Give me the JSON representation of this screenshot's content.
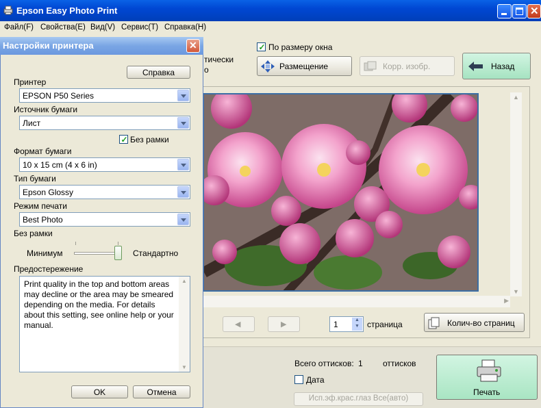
{
  "window": {
    "title": "Epson Easy Photo Print"
  },
  "menu": [
    "Файл(F)",
    "Свойства(E)",
    "Вид(V)",
    "Сервис(T)",
    "Справка(H)"
  ],
  "toolbar": {
    "fit_window_label": "По размеру окна",
    "fit_window_checked": true,
    "placement_label": "Размещение",
    "correct_label": "Корр. изобр.",
    "back_label": "Назад",
    "partial_text_1": "тически",
    "partial_text_2": "о"
  },
  "pager": {
    "page_value": "1",
    "page_label": "страница",
    "pages_count_button": "Колич-во страниц"
  },
  "bottom": {
    "total_label": "Всего оттисков:",
    "total_value": "1",
    "total_unit": "оттисков",
    "date_label": "Дата",
    "date_checked": false,
    "redeye_label": "Исп.эф.крас.глаз Все(авто)",
    "print_label": "Печать"
  },
  "dialog": {
    "title": "Настройки принтера",
    "help_button": "Справка",
    "printer_label": "Принтер",
    "printer_value": "EPSON P50 Series",
    "source_label": "Источник бумаги",
    "source_value": "Лист",
    "borderless_check_label": "Без рамки",
    "borderless_checked": true,
    "size_label": "Формат бумаги",
    "size_value": "10 x 15 cm (4 x 6 in)",
    "type_label": "Тип бумаги",
    "type_value": "Epson Glossy",
    "mode_label": "Режим печати",
    "mode_value": "Best Photo",
    "expansion_label": "Без рамки",
    "slider_min": "Минимум",
    "slider_max": "Стандартно",
    "warning_label": "Предостережение",
    "warning_text": "Print quality in the top and bottom areas may decline or the area may be smeared depending on the media. For details about this setting, see online help or your manual.",
    "ok_button": "OK",
    "cancel_button": "Отмена"
  },
  "colors": {
    "titlebar": "#0a5ae0",
    "dialog_title": "#7aa6e4",
    "print_button": "#b8ebcf",
    "selection_border": "#3b6ea5"
  }
}
